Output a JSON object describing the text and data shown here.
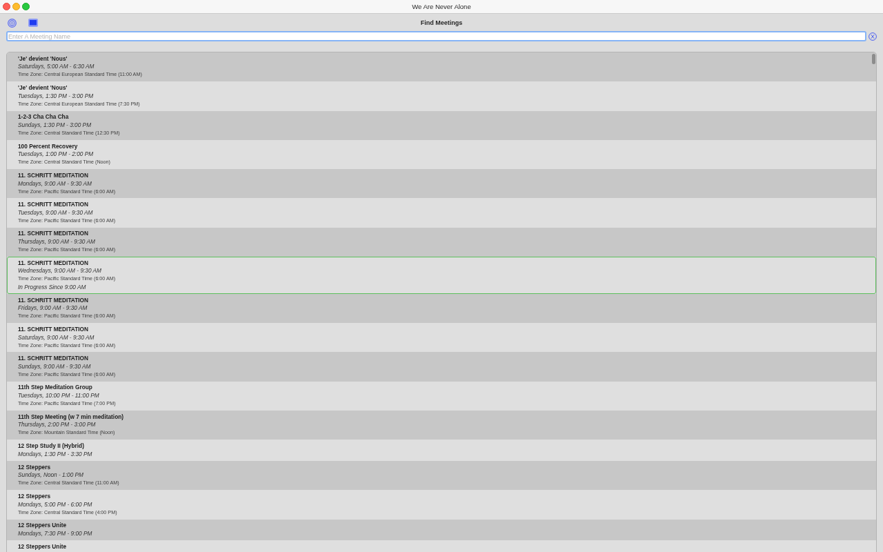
{
  "window": {
    "title": "We Are Never Alone"
  },
  "toolbar": {
    "title": "Find Meetings"
  },
  "search": {
    "placeholder": "Enter A Meeting Name"
  },
  "meetings": [
    {
      "name": "'Je' devient 'Nous'",
      "schedule": "Saturdays, 5:00 AM - 6:30 AM",
      "time_zone": "Time Zone: Central European Standard Time (11:00 AM)",
      "in_progress": false
    },
    {
      "name": "'Je' devient 'Nous'",
      "schedule": "Tuesdays, 1:30 PM - 3:00 PM",
      "time_zone": "Time Zone: Central European Standard Time (7:30 PM)",
      "in_progress": false
    },
    {
      "name": "1-2-3 Cha Cha Cha",
      "schedule": "Sundays, 1:30 PM - 3:00 PM",
      "time_zone": "Time Zone: Central Standard Time (12:30 PM)",
      "in_progress": false
    },
    {
      "name": "100 Percent Recovery",
      "schedule": "Tuesdays, 1:00 PM - 2:00 PM",
      "time_zone": "Time Zone: Central Standard Time (Noon)",
      "in_progress": false
    },
    {
      "name": "11. SCHRITT MEDITATION",
      "schedule": "Mondays, 9:00 AM - 9:30 AM",
      "time_zone": "Time Zone: Pacific Standard Time (6:00 AM)",
      "in_progress": false
    },
    {
      "name": "11. SCHRITT MEDITATION",
      "schedule": "Tuesdays, 9:00 AM - 9:30 AM",
      "time_zone": "Time Zone: Pacific Standard Time (6:00 AM)",
      "in_progress": false
    },
    {
      "name": "11. SCHRITT MEDITATION",
      "schedule": "Thursdays, 9:00 AM - 9:30 AM",
      "time_zone": "Time Zone: Pacific Standard Time (6:00 AM)",
      "in_progress": false
    },
    {
      "name": "11. SCHRITT MEDITATION",
      "schedule": "Wednesdays, 9:00 AM - 9:30 AM",
      "time_zone": "Time Zone: Pacific Standard Time (6:00 AM)",
      "status": "In Progress Since 9:00 AM",
      "in_progress": true
    },
    {
      "name": "11. SCHRITT MEDITATION",
      "schedule": "Fridays, 9:00 AM - 9:30 AM",
      "time_zone": "Time Zone: Pacific Standard Time (6:00 AM)",
      "in_progress": false
    },
    {
      "name": "11. SCHRITT MEDITATION",
      "schedule": "Saturdays, 9:00 AM - 9:30 AM",
      "time_zone": "Time Zone: Pacific Standard Time (6:00 AM)",
      "in_progress": false
    },
    {
      "name": "11. SCHRITT MEDITATION",
      "schedule": "Sundays, 9:00 AM - 9:30 AM",
      "time_zone": "Time Zone: Pacific Standard Time (6:00 AM)",
      "in_progress": false
    },
    {
      "name": "11th Step Meditation Group",
      "schedule": "Tuesdays, 10:00 PM - 11:00 PM",
      "time_zone": "Time Zone: Pacific Standard Time (7:00 PM)",
      "in_progress": false
    },
    {
      "name": "11th Step Meeting (w 7 min meditation)",
      "schedule": "Thursdays, 2:00 PM - 3:00 PM",
      "time_zone": "Time Zone: Mountain Standard Time (Noon)",
      "in_progress": false
    },
    {
      "name": "12 Step Study II (Hybrid)",
      "schedule": "Mondays, 1:30 PM - 3:30 PM",
      "in_progress": false
    },
    {
      "name": "12 Steppers",
      "schedule": "Sundays, Noon - 1:00 PM",
      "time_zone": "Time Zone: Central Standard Time (11:00 AM)",
      "in_progress": false
    },
    {
      "name": "12 Steppers",
      "schedule": "Mondays, 5:00 PM - 6:00 PM",
      "time_zone": "Time Zone: Central Standard Time (4:00 PM)",
      "in_progress": false
    },
    {
      "name": "12 Steppers Unite",
      "schedule": "Mondays, 7:30 PM - 9:00 PM",
      "in_progress": false
    },
    {
      "name": "12 Steppers Unite",
      "in_progress": false
    }
  ]
}
